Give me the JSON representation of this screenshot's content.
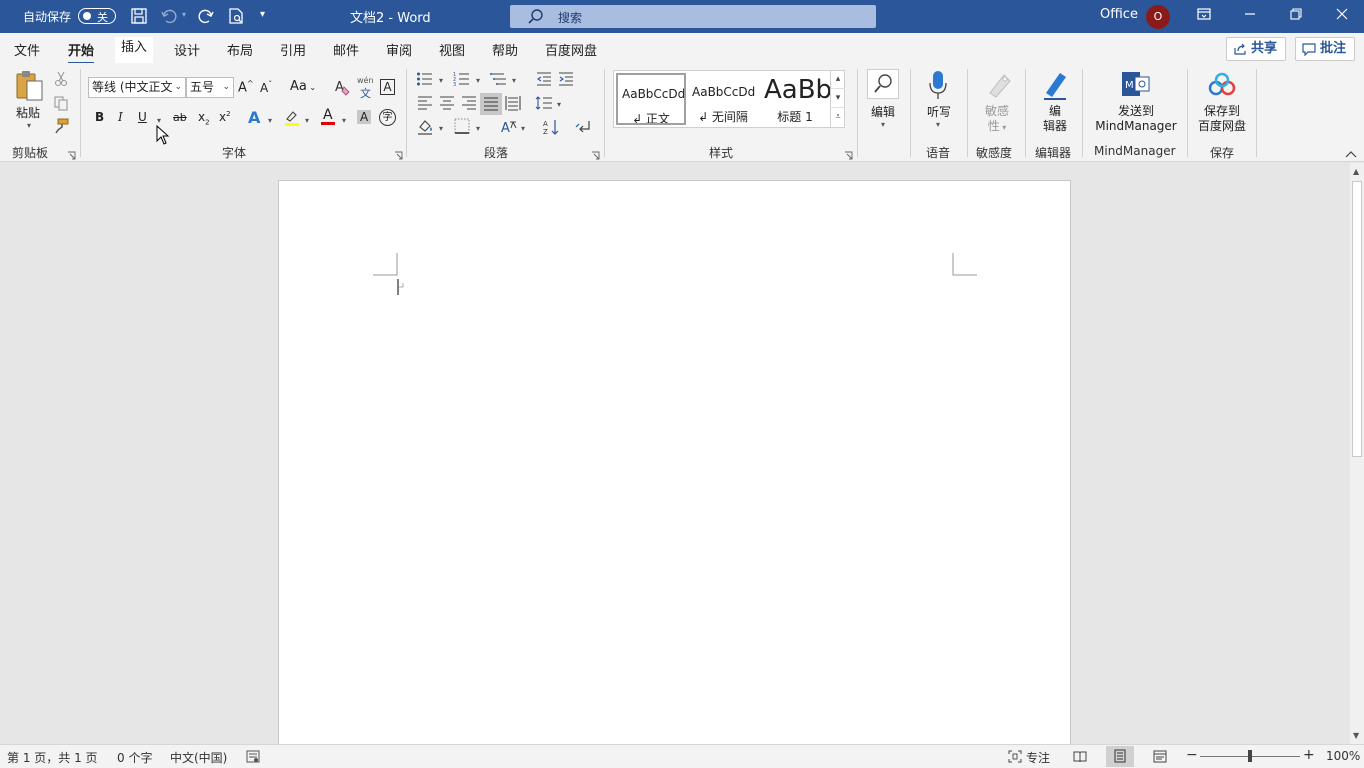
{
  "titlebar": {
    "autosave_label": "自动保存",
    "autosave_state": "关",
    "doc_title": "文档2  -  Word",
    "search_placeholder": "搜索",
    "account": "Office",
    "avatar_initial": "O"
  },
  "tabs": [
    "文件",
    "开始",
    "插入",
    "设计",
    "布局",
    "引用",
    "邮件",
    "审阅",
    "视图",
    "帮助",
    "百度网盘"
  ],
  "active_tab": "开始",
  "share_label": "共享",
  "comment_label": "批注",
  "ribbon": {
    "clipboard": {
      "paste_label": "粘贴",
      "group_label": "剪贴板"
    },
    "font": {
      "font_name": "等线 (中文正文",
      "font_size": "五号",
      "grow": "A",
      "shrink": "A",
      "change_case": "Aa",
      "pinyin_top": "wén",
      "pinyin_bottom": "文",
      "char_border": "A",
      "bold": "B",
      "italic": "I",
      "underline": "U",
      "strike": "ab",
      "subscript": "x",
      "superscript": "x",
      "text_effects": "A",
      "font_color": "A",
      "char_shading": "A",
      "enclose": "字",
      "group_label": "字体"
    },
    "paragraph": {
      "group_label": "段落"
    },
    "styles": {
      "items": [
        {
          "sample": "AaBbCcDd",
          "name": "↲ 正文"
        },
        {
          "sample": "AaBbCcDd",
          "name": "↲ 无间隔"
        },
        {
          "sample": "AaBb",
          "name": "标题 1"
        }
      ],
      "group_label": "样式"
    },
    "editing": {
      "label": "编辑"
    },
    "voice": {
      "label": "听写",
      "group_label": "语音"
    },
    "sensitivity": {
      "label_line1": "敏感",
      "label_line2": "性",
      "group_label": "敏感度"
    },
    "editor": {
      "label_line1": "编",
      "label_line2": "辑器",
      "group_label": "编辑器"
    },
    "mindmanager": {
      "label_line1": "发送到",
      "label_line2": "MindManager",
      "group_label": "MindManager"
    },
    "save": {
      "label_line1": "保存到",
      "label_line2": "百度网盘",
      "group_label": "保存"
    }
  },
  "statusbar": {
    "page": "第 1 页，共 1 页",
    "words": "0 个字",
    "language": "中文(中国)",
    "focus": "专注",
    "zoom_minus": "−",
    "zoom_plus": "+",
    "zoom": "100%",
    "zoom_fraction": 0.5
  },
  "colors": {
    "title_bar": "#2b579a",
    "highlight": "#ffff00",
    "font_color": "#e00000"
  }
}
